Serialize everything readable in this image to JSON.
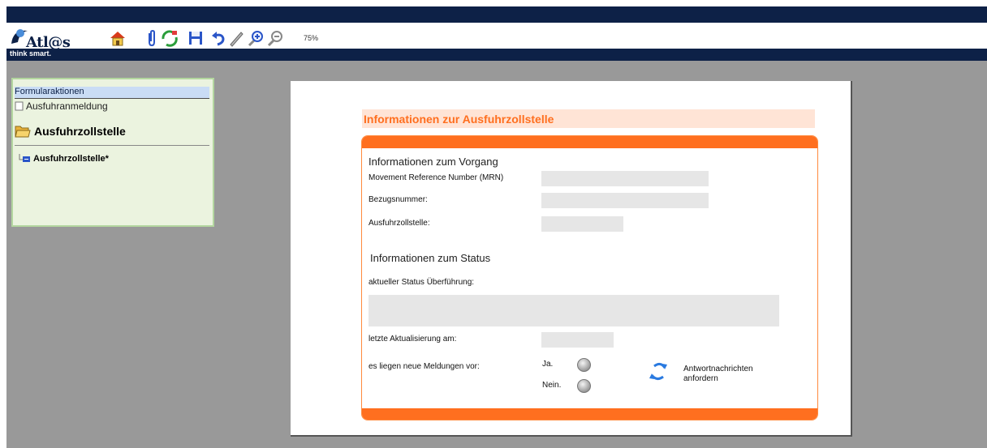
{
  "toolbar": {
    "logo_text": "Atl@s",
    "slogan": "think smart.",
    "zoom": "75%",
    "icons": [
      "home-icon",
      "attachment-icon",
      "refresh-icon",
      "save-icon",
      "undo-icon",
      "pen-icon",
      "zoom-in-icon",
      "zoom-out-icon"
    ]
  },
  "sidebar": {
    "header": "Formularaktionen",
    "item": "Ausfuhranmeldung",
    "folder": "Ausfuhrzollstelle",
    "sub_item": "Ausfuhrzollstelle*"
  },
  "form": {
    "title": "Informationen zur Ausfuhrzollstelle",
    "section1": "Informationen zum Vorgang",
    "mrn_label": "Movement Reference Number (MRN)",
    "bezug_label": "Bezugsnummer:",
    "zollstelle_label": "Ausfuhrzollstelle:",
    "section2": "Informationen zum Status",
    "status_label": "aktueller Status Überführung:",
    "update_label": "letzte Aktualisierung am:",
    "new_msgs_label": "es liegen neue Meldungen vor:",
    "yes_label": "Ja.",
    "no_label": "Nein.",
    "request_button_line1": "Antwortnachrichten",
    "request_button_line2": "anfordern"
  },
  "colors": {
    "accent": "#ff6f1f",
    "navy": "#0d2147",
    "sidebar_bg": "#ebf3df"
  }
}
